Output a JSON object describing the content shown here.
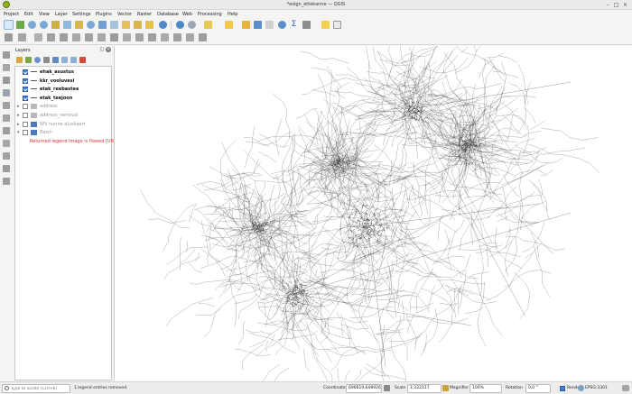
{
  "window": {
    "title": "*esign_ettekanne — QGIS"
  },
  "menu": [
    "Project",
    "Edit",
    "View",
    "Layer",
    "Settings",
    "Plugins",
    "Vector",
    "Raster",
    "Database",
    "Web",
    "Processing",
    "Help"
  ],
  "layers_panel": {
    "title": "Layers",
    "layers": [
      {
        "name": "ehak_asustus",
        "checked": true,
        "style": "bold",
        "expand": ""
      },
      {
        "name": "kkr_vooluvesi",
        "checked": true,
        "style": "bold",
        "expand": ""
      },
      {
        "name": "etak_reebastee",
        "checked": true,
        "style": "bold",
        "expand": ""
      },
      {
        "name": "etak_teejoon",
        "checked": true,
        "style": "bold",
        "expand": ""
      },
      {
        "name": "address",
        "checked": false,
        "style": "dim",
        "expand": "▸"
      },
      {
        "name": "address_removal",
        "checked": false,
        "style": "dim",
        "expand": "▸"
      },
      {
        "name": "WV nunne aluskaart",
        "checked": false,
        "style": "dim",
        "expand": "▸"
      },
      {
        "name": "Basm",
        "checked": false,
        "style": "dim",
        "expand": "▾"
      }
    ],
    "error_text": "Returned legend image is flawed [URL..."
  },
  "status": {
    "locator_placeholder": "Type to locate (Ctrl+K)",
    "message": "1 legend entries removed.",
    "coordinate_label": "Coordinate",
    "coordinate_value": "696619,6489266",
    "scale_label": "Scale",
    "scale_value": "1:322117",
    "magnifier_label": "Magnifier",
    "magnifier_value": "100%",
    "rotation_label": "Rotation",
    "rotation_value": "0,0 °",
    "render_label": "Render",
    "crs": "EPSG:3301"
  },
  "colors": {
    "accent": "#3d7fd6",
    "error": "#e03030",
    "qgis_green": "#93b023"
  }
}
